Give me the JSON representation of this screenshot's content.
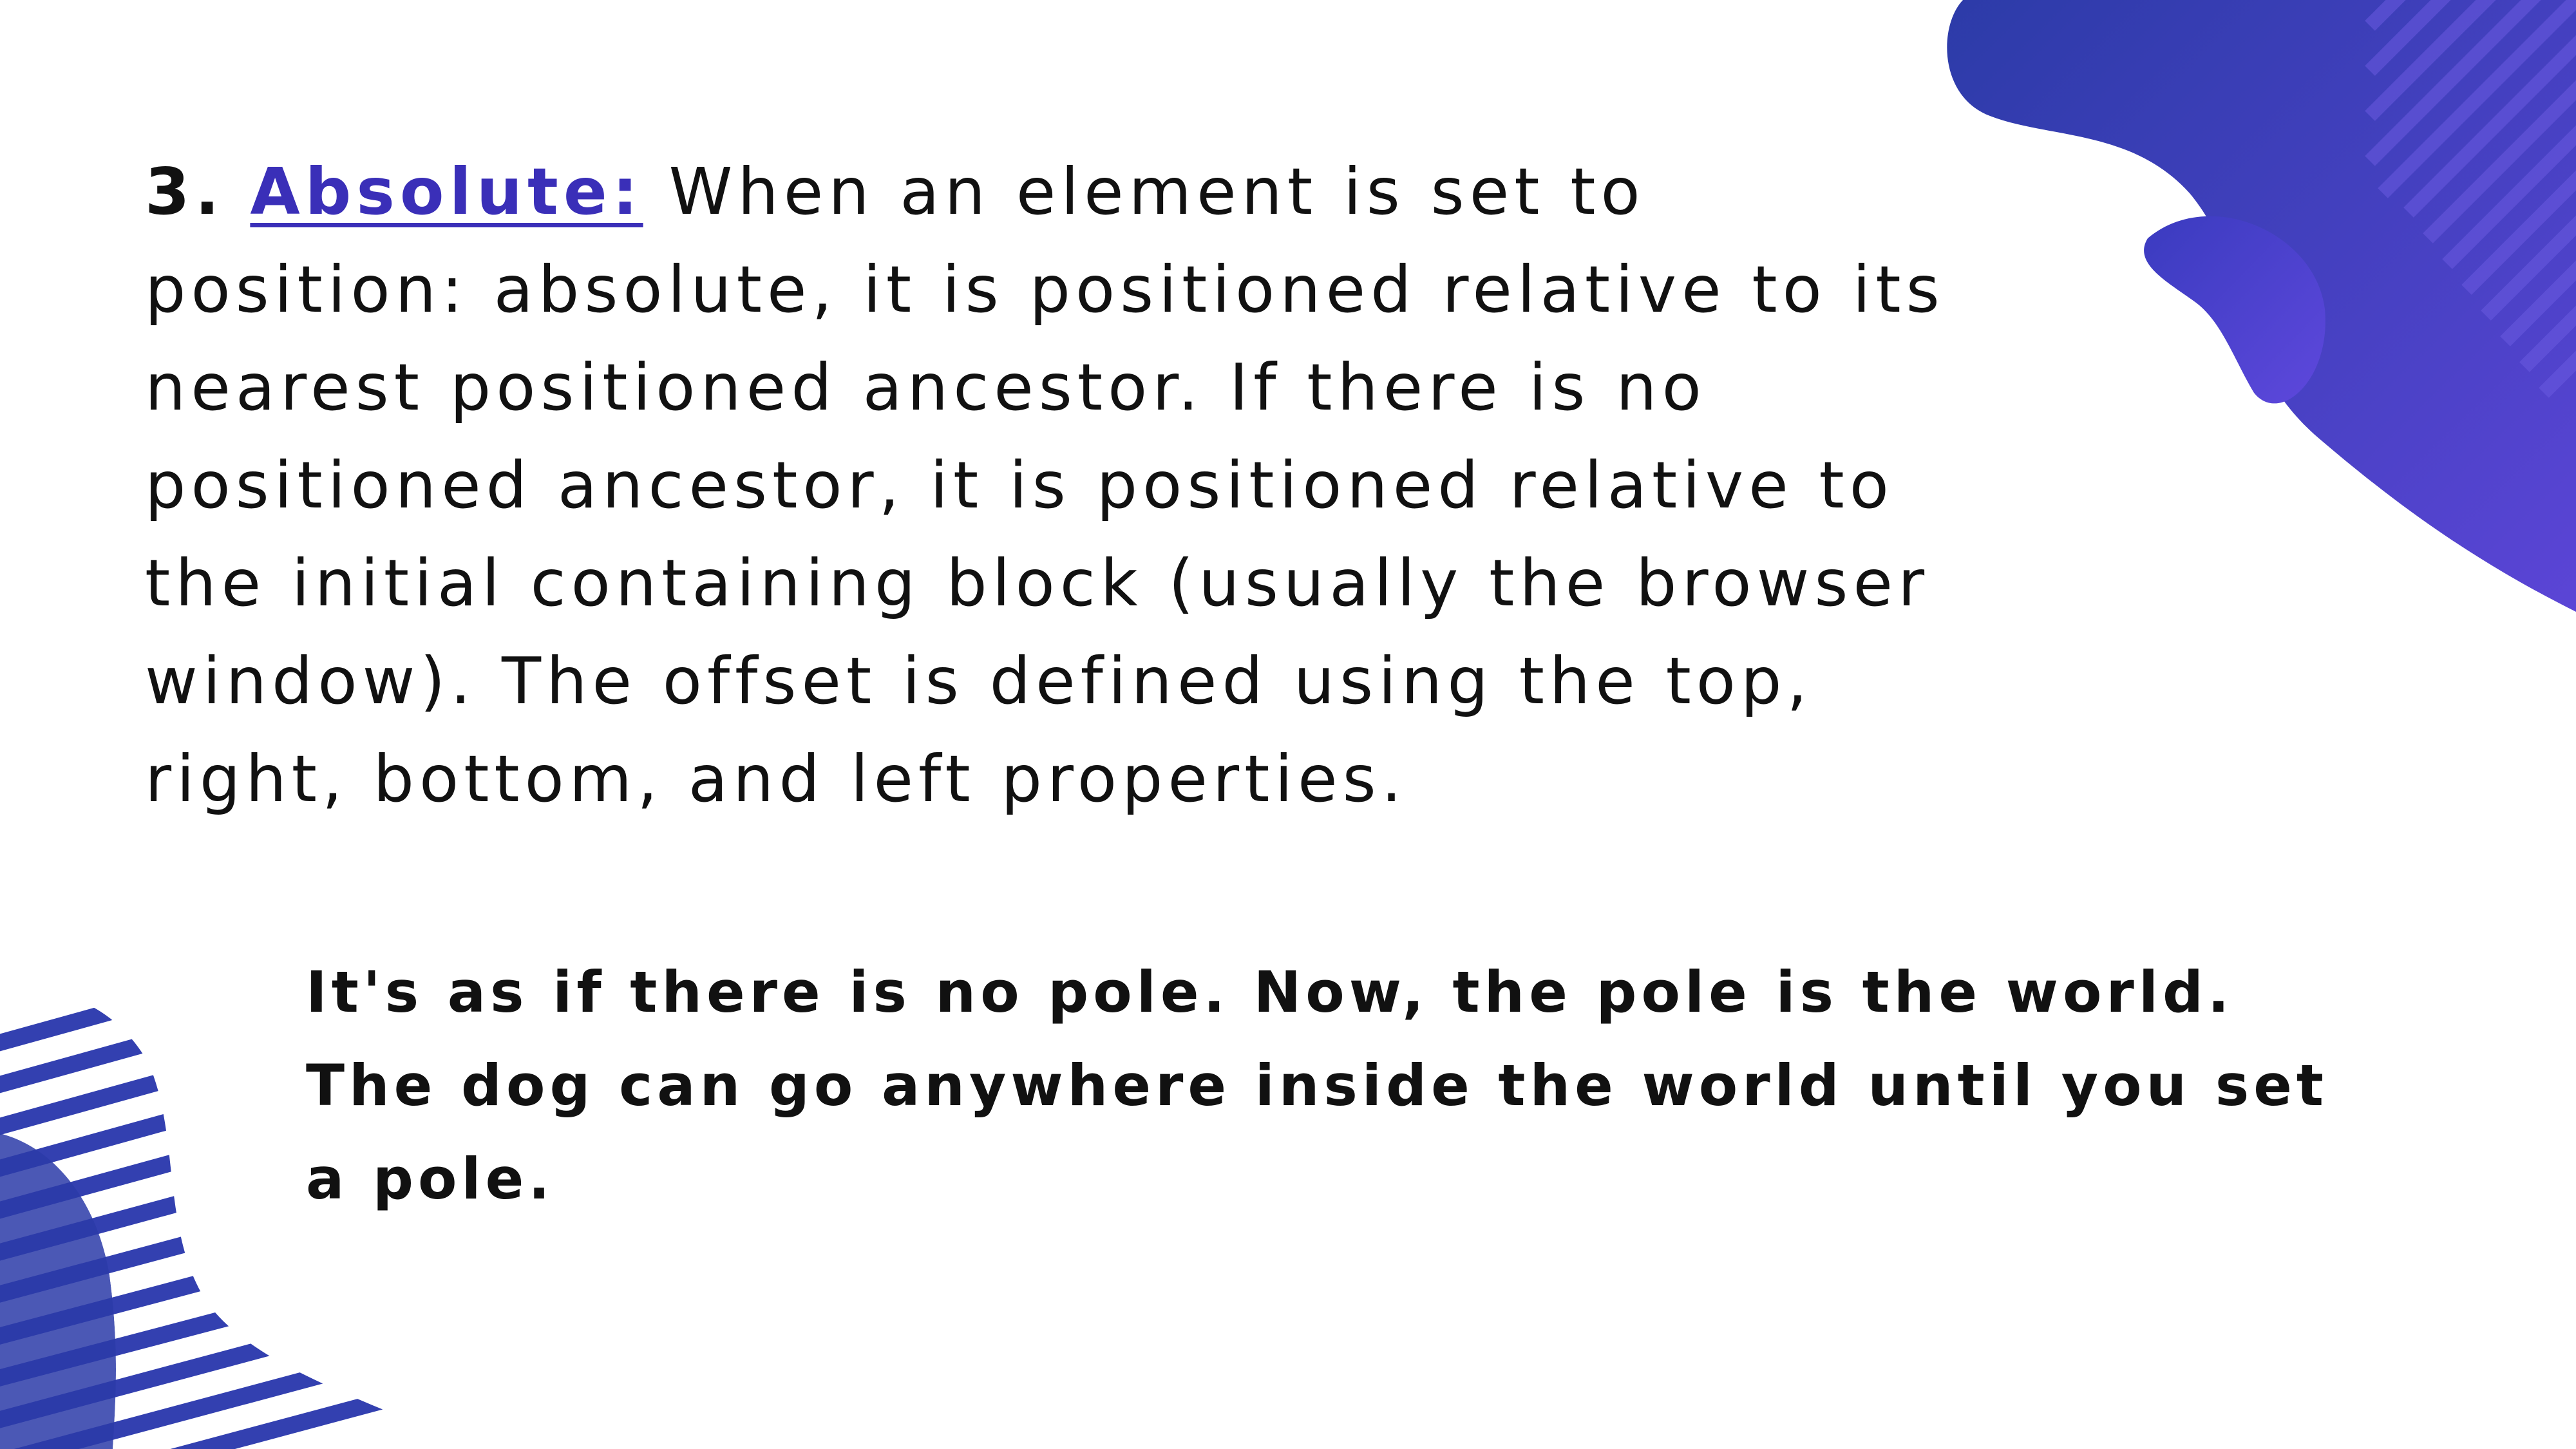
{
  "colors": {
    "accent": "#3a2fb8",
    "blob_light": "#5b45d6",
    "blob_dark": "#2c3ba8",
    "stripe": "#3340b0",
    "text": "#111111"
  },
  "section": {
    "number": "3.",
    "term": "Absolute:",
    "body": " When an element is set to position: absolute, it is positioned relative to its nearest positioned ancestor. If there is no positioned ancestor, it is positioned relative to the initial containing block (usually the browser window). The offset is defined using the top, right, bottom, and left properties."
  },
  "analogy": {
    "text": "It's as if there is no pole. Now, the pole is the world. The dog can go anywhere inside the world until you set a pole."
  }
}
